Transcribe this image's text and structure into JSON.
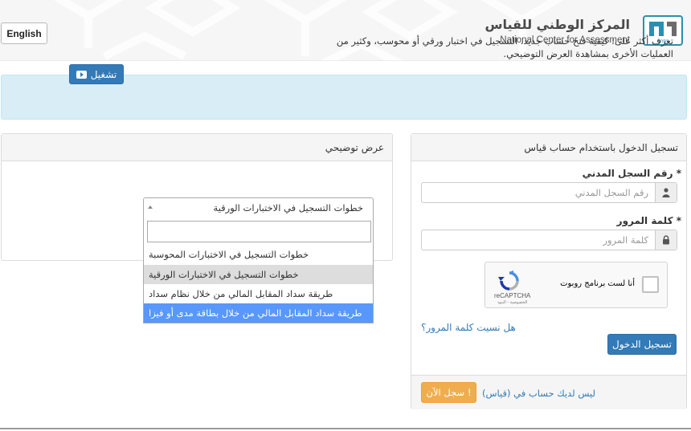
{
  "header": {
    "lang_button": "English",
    "logo_arabic": "المركز الوطني للقياس",
    "logo_english": "National Center for Assessment",
    "logo_mark_text": "QIYAS"
  },
  "demo_panel": {
    "title": "عرض توضيحي",
    "description": "تعرف أكثر على: كيفية فتح حساب جديد، التسجيل في اختبار ورقي أو محوسب، وكثير من العمليات الأخرى بمشاهدة العرض التوضيحي.",
    "play_button": "تشغيل",
    "select_value": "خطوات التسجيل في الاختبارات الورقية",
    "search_placeholder": "",
    "options": [
      "خطوات التسجيل في الاختبارات المحوسبة",
      "خطوات التسجيل في الاختبارات الورقية",
      "طريقة سداد المقابل المالي من خلال نظام سداد",
      "طريقة سداد المقابل المالي من خلال بطاقة مدى أو فيزا"
    ]
  },
  "login_panel": {
    "title": "تسجيل الدخول باستخدام حساب قياس",
    "id_label": "رقم السجل المدني *",
    "id_placeholder": "رقم السجل المدني",
    "password_label": "كلمة المرور *",
    "password_placeholder": "كلمة المرور",
    "captcha_text": "أنا لست برنامج روبوت",
    "captcha_brand": "reCAPTCHA",
    "captcha_terms": "الخصوصية - البنود",
    "forgot_password": "هل نسيت كلمة المرور؟",
    "login_button": "تسجيل الدخول",
    "no_account": "ليس لديك حساب في (قياس)",
    "signup_button": "سجل الآن !"
  },
  "colors": {
    "primary": "#337ab7",
    "warning": "#f0ad4e",
    "alert_bg": "#d9edf7",
    "dropdown_highlight": "#5897fb"
  },
  "icons": {
    "user": "user-icon",
    "lock": "lock-icon",
    "play": "youtube-play-icon",
    "captcha": "recaptcha-icon"
  }
}
